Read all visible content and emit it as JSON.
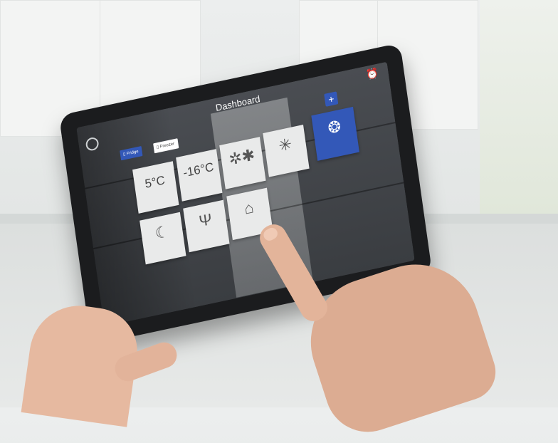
{
  "app": {
    "title": "Dashboard"
  },
  "modes": [
    {
      "label": "Fridge",
      "active": true
    },
    {
      "label": "Freezer",
      "active": false
    }
  ],
  "tiles": [
    {
      "main": "5°C",
      "icon": null
    },
    {
      "main": "-16°C",
      "icon": null
    },
    {
      "main": "",
      "icon": "snowflakes-icon"
    },
    {
      "main": "",
      "icon": "snowflake-icon"
    },
    {
      "main": "",
      "icon": "moon-icon"
    },
    {
      "main": "",
      "icon": "menorah-icon"
    },
    {
      "main": "",
      "icon": "vacation-icon"
    },
    {
      "main": "",
      "icon": "ice-icon",
      "active": true
    }
  ],
  "colors": {
    "accent": "#3358b8",
    "alert": "#e0313a",
    "tile_bg": "#e9eaea"
  }
}
